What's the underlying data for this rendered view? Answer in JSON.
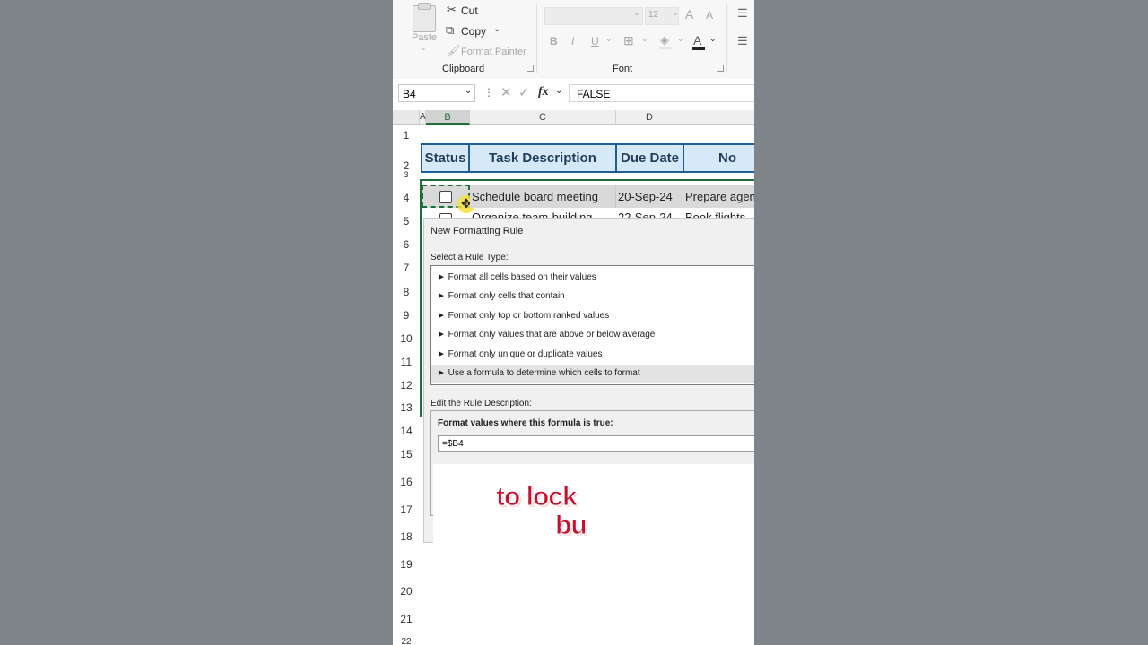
{
  "ribbon": {
    "paste": "Paste",
    "cut": "Cut",
    "copy": "Copy",
    "format_painter": "Format Painter",
    "clipboard_group": "Clipboard",
    "font_group": "Font",
    "font_size": "12",
    "bold": "B",
    "italic": "I",
    "underline": "U",
    "font_color_glyph": "A",
    "grow_glyph": "A",
    "shrink_glyph": "A"
  },
  "formula_bar": {
    "name_box": "B4",
    "fx": "fx",
    "value": "FALSE"
  },
  "sheet": {
    "columns": [
      "A",
      "B",
      "C",
      "D"
    ],
    "rows": [
      "1",
      "2",
      "3",
      "4",
      "5",
      "6",
      "7",
      "8",
      "9",
      "10",
      "11",
      "12",
      "13",
      "14",
      "15",
      "16",
      "17",
      "18",
      "19",
      "20",
      "21",
      "22"
    ],
    "headers": [
      "Status",
      "Task Description",
      "Due Date",
      "No"
    ],
    "row4": {
      "task": "Schedule board meeting",
      "date": "20-Sep-24",
      "notes": "Prepare agen"
    },
    "row5": {
      "task": "Organize team-building",
      "date": "22-Sep-24",
      "notes": "Book flights"
    }
  },
  "dialog": {
    "title": "New Formatting Rule",
    "select_label": "Select a Rule Type:",
    "rule_types": [
      "► Format all cells based on their values",
      "► Format only cells that contain",
      "► Format only top or bottom ranked values",
      "► Format only values that are above or below average",
      "► Format only unique or duplicate values",
      "► Use a formula to determine which cells to format"
    ],
    "edit_label": "Edit the Rule Description:",
    "formula_label": "Format values where this formula is true:",
    "formula_value": "=$B4"
  },
  "captions": {
    "line1": "to lock",
    "line2": "bu"
  },
  "colors": {
    "accent": "#1e6e3a",
    "header_fill": "#d6e9f8",
    "header_border": "#1e5f96",
    "caption": "#c8102e"
  }
}
